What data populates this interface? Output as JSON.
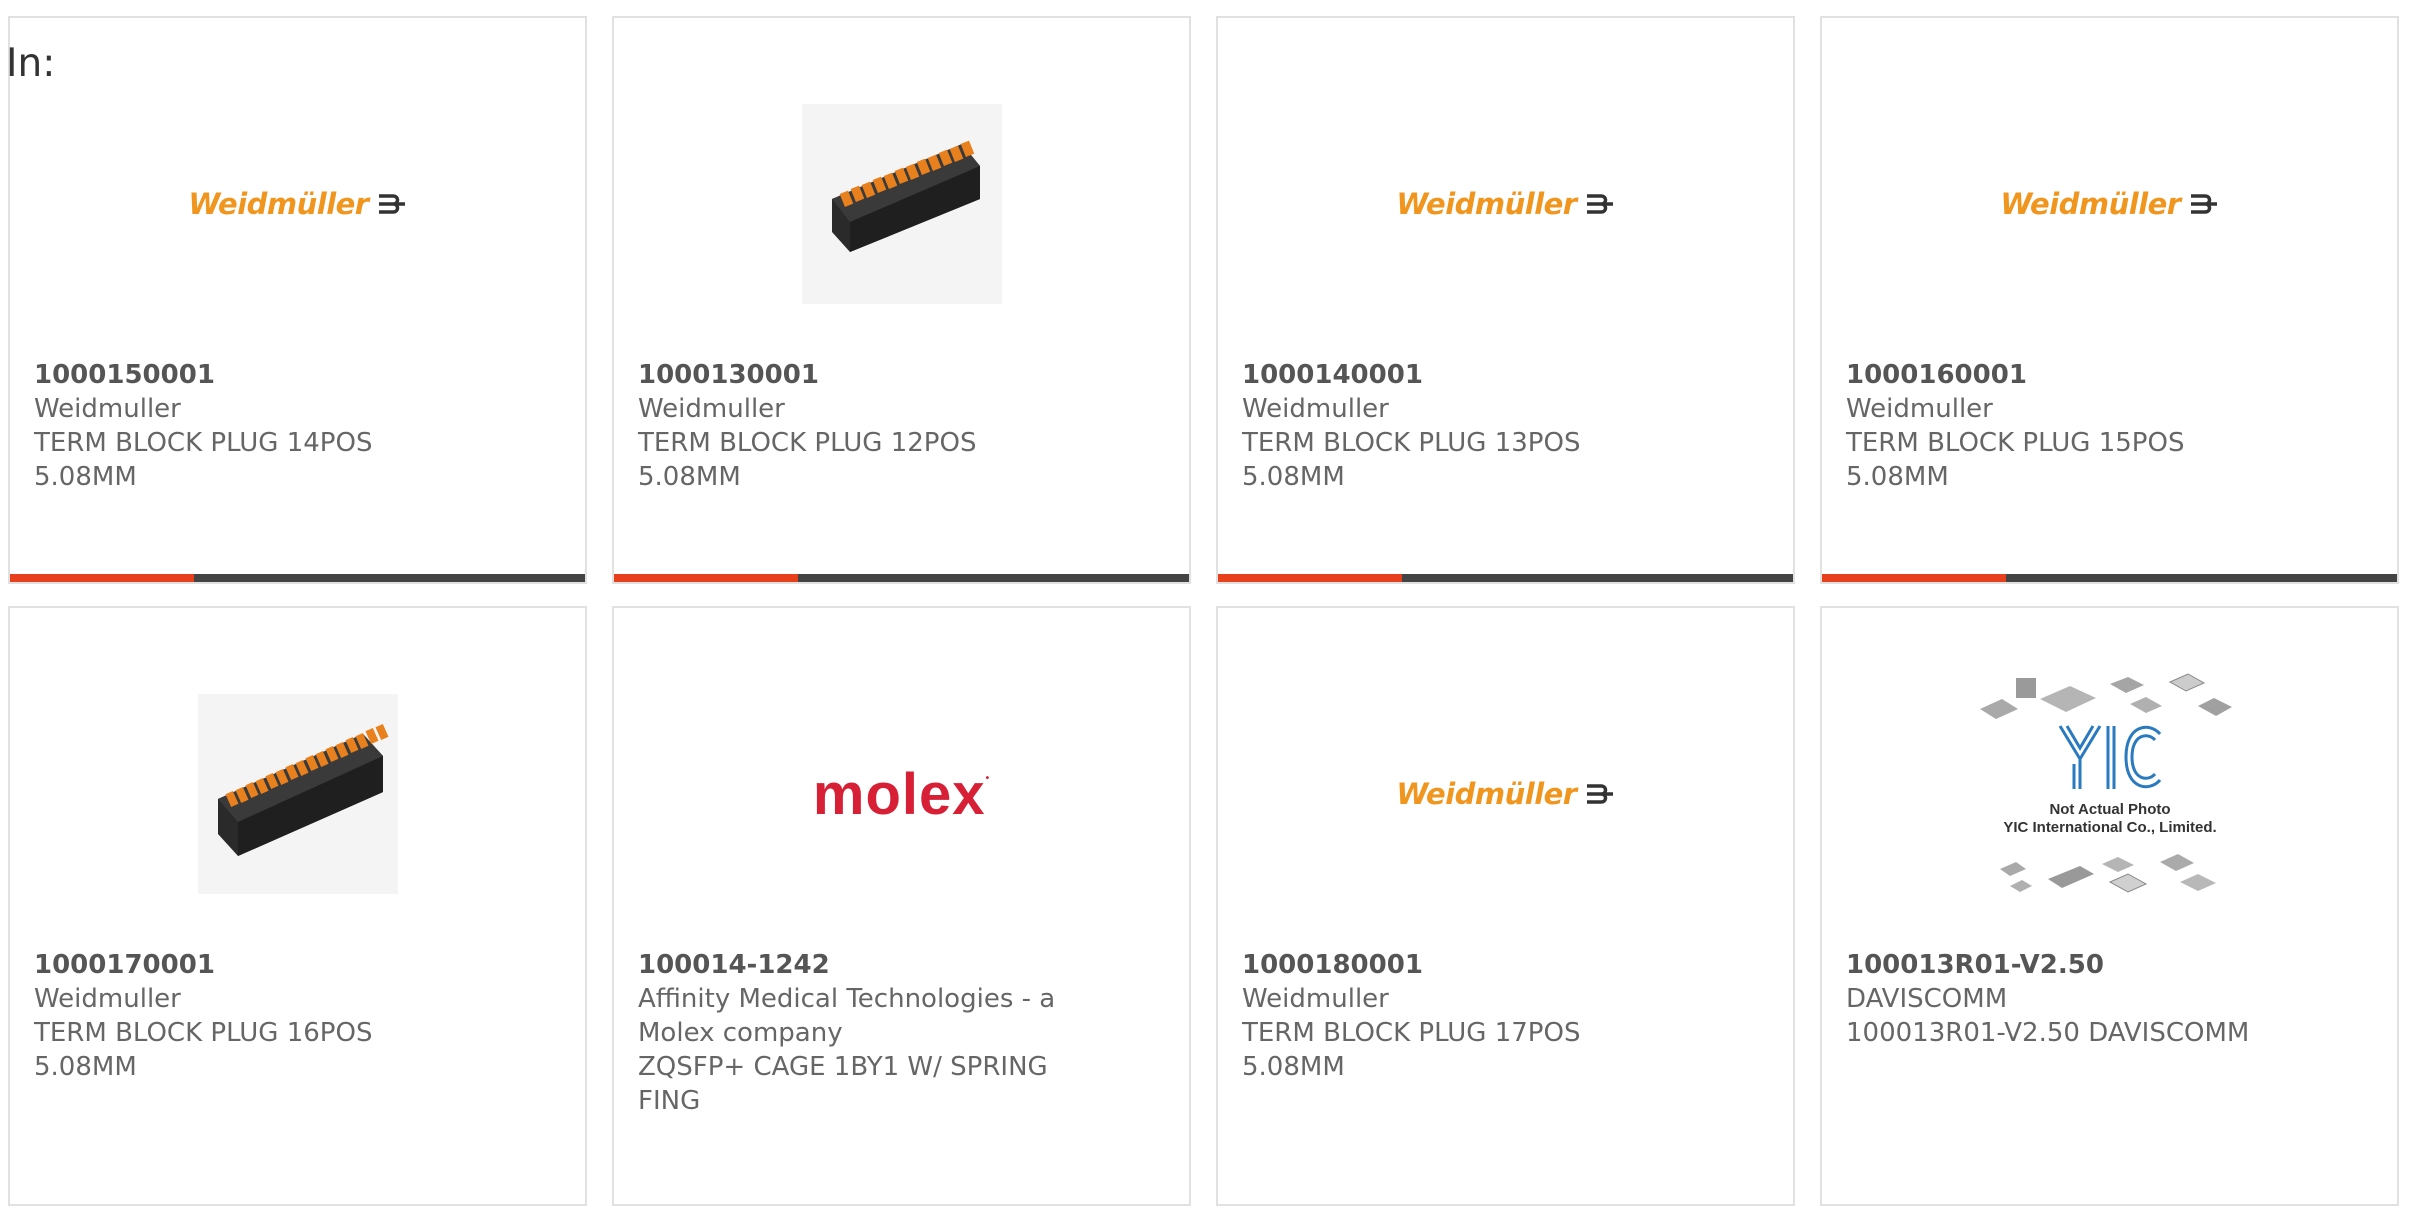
{
  "page": {
    "in_label": "In:"
  },
  "colors": {
    "accent_bar": "#e8401c",
    "bar_dark": "#444444",
    "weidmuller_orange": "#f0961e",
    "molex_red": "#d71f35",
    "yic_blue": "#2a7ac0"
  },
  "products": [
    {
      "part_number": "1000150001",
      "manufacturer": "Weidmuller",
      "desc_line1": "TERM BLOCK PLUG 14POS",
      "desc_line2": "5.08MM",
      "image": "weidmuller-logo",
      "logo_text": "Weidmüller"
    },
    {
      "part_number": "1000130001",
      "manufacturer": "Weidmuller",
      "desc_line1": "TERM BLOCK PLUG 12POS",
      "desc_line2": "5.08MM",
      "image": "terminal-block-photo"
    },
    {
      "part_number": "1000140001",
      "manufacturer": "Weidmuller",
      "desc_line1": "TERM BLOCK PLUG 13POS",
      "desc_line2": "5.08MM",
      "image": "weidmuller-logo",
      "logo_text": "Weidmüller"
    },
    {
      "part_number": "1000160001",
      "manufacturer": "Weidmuller",
      "desc_line1": "TERM BLOCK PLUG 15POS",
      "desc_line2": "5.08MM",
      "image": "weidmuller-logo",
      "logo_text": "Weidmüller"
    },
    {
      "part_number": "1000170001",
      "manufacturer": "Weidmuller",
      "desc_line1": "TERM BLOCK PLUG 16POS",
      "desc_line2": "5.08MM",
      "image": "terminal-block-photo"
    },
    {
      "part_number": "100014-1242",
      "manufacturer_line1": "Affinity Medical Technologies - a",
      "manufacturer_line2": "Molex company",
      "desc_line1": "ZQSFP+ CAGE 1BY1 W/ SPRING",
      "desc_line2": "FING",
      "image": "molex-logo",
      "logo_text": "molex"
    },
    {
      "part_number": "1000180001",
      "manufacturer": "Weidmuller",
      "desc_line1": "TERM BLOCK PLUG 17POS",
      "desc_line2": "5.08MM",
      "image": "weidmuller-logo",
      "logo_text": "Weidmüller"
    },
    {
      "part_number": "100013R01-V2.50",
      "manufacturer": "DAVISCOMM",
      "desc_line1": "100013R01-V2.50 DAVISCOMM",
      "image": "yic-placeholder",
      "placeholder_line1": "Not Actual Photo",
      "placeholder_line2": "YIC International Co., Limited."
    }
  ]
}
